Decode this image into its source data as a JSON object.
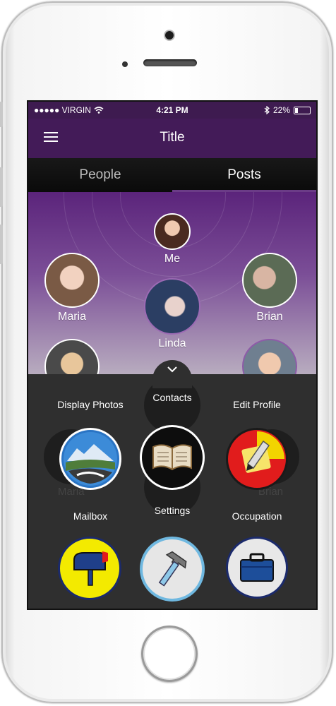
{
  "status": {
    "carrier": "●●●●● VIRGIN",
    "time": "4:21 PM",
    "battery": "22%",
    "battery_fraction": 0.22
  },
  "nav": {
    "title": "Title"
  },
  "tabs": [
    {
      "label": "People"
    },
    {
      "label": "Posts"
    }
  ],
  "people": [
    {
      "name": "Me"
    },
    {
      "name": "Maria"
    },
    {
      "name": "Brian"
    },
    {
      "name": "Linda"
    }
  ],
  "ghost_labels": {
    "maria": "Maria",
    "brian": "Brian"
  },
  "menu": [
    {
      "label": "Display Photos",
      "icon": "landscape-icon"
    },
    {
      "label": "Contacts",
      "icon": "book-icon"
    },
    {
      "label": "Edit Profile",
      "icon": "note-pencil-icon"
    },
    {
      "label": "Mailbox",
      "icon": "mailbox-icon"
    },
    {
      "label": "Settings",
      "icon": "hammer-icon"
    },
    {
      "label": "Occupation",
      "icon": "briefcase-icon"
    }
  ],
  "colors": {
    "purple": "#431b58",
    "accent": "#6b3c87"
  }
}
